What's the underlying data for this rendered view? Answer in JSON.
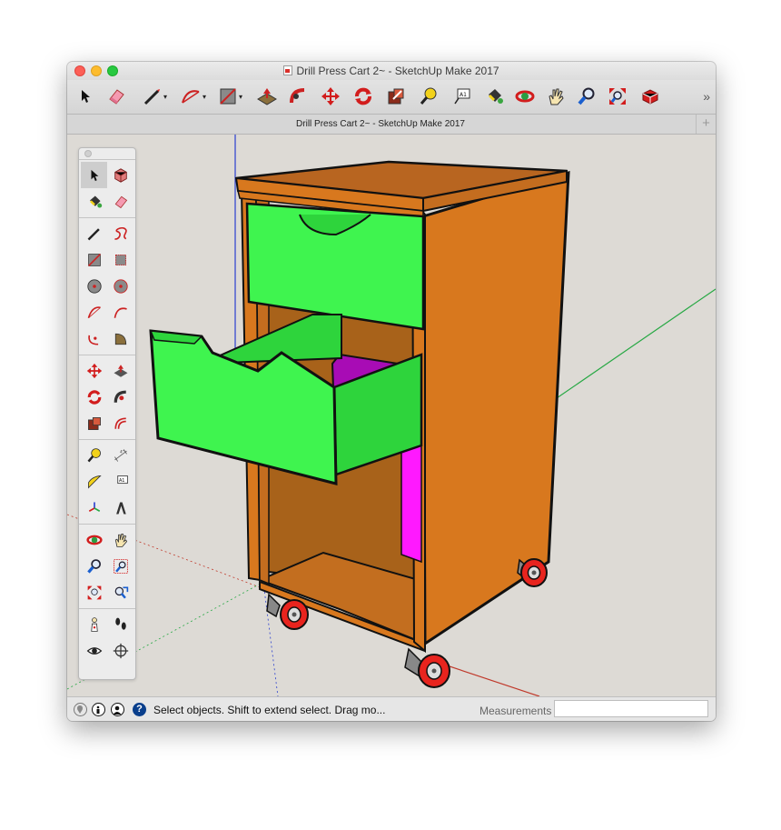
{
  "window": {
    "title": "Drill Press Cart 2~ - SketchUp Make 2017",
    "doc_tab_title": "Drill Press Cart 2~ - SketchUp Make 2017",
    "new_tab_symbol": "+",
    "toolbar_overflow_symbol": "»"
  },
  "toolbar": {
    "tools": [
      "select",
      "eraser",
      "line",
      "arc",
      "shape",
      "push-pull",
      "follow-me",
      "move",
      "rotate",
      "scale",
      "tape-measure",
      "text",
      "paint-bucket",
      "orbit",
      "pan",
      "zoom",
      "zoom-extents",
      "3d-warehouse"
    ]
  },
  "palette": {
    "groups": [
      [
        "select",
        "make-component",
        "paint-bucket",
        "eraser"
      ],
      [
        "line",
        "freehand",
        "rectangle",
        "rotated-rectangle",
        "circle",
        "polygon",
        "arc",
        "two-point-arc",
        "three-point-arc",
        "pie"
      ],
      [
        "move",
        "push-pull",
        "rotate",
        "follow-me",
        "scale",
        "offset"
      ],
      [
        "tape-measure",
        "dimension",
        "protractor",
        "text",
        "axes",
        "3d-text"
      ],
      [
        "orbit",
        "pan",
        "zoom",
        "zoom-window",
        "zoom-extents",
        "previous-view"
      ],
      [
        "position-camera",
        "walk",
        "look-around",
        "section-plane"
      ]
    ]
  },
  "statusbar": {
    "message": "Select objects. Shift to extend select. Drag mo...",
    "measurements_label": "Measurements",
    "measurements_value": ""
  },
  "model": {
    "name": "Drill Press Cart",
    "colors": {
      "cabinet_orange": "#d8781e",
      "cabinet_dark": "#a8621a",
      "drawer_green": "#3ff44f",
      "drawer_inner": "#2ed43c",
      "magenta": "#ff19ff",
      "purple": "#a80cb5",
      "wheel_red": "#e8241e"
    }
  },
  "colors": {
    "accent": "#0a66d6",
    "axis_red": "#c0392b",
    "axis_green": "#27a844",
    "axis_blue": "#2a3fcf"
  }
}
